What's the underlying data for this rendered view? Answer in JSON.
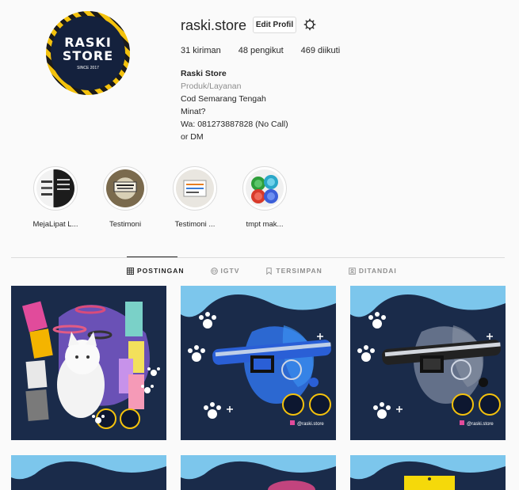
{
  "profile": {
    "avatar_text_line1": "RASKI",
    "avatar_text_line2": "STORE",
    "avatar_small": "SINCE 2017",
    "username": "raski.store",
    "edit_label": "Edit Profil",
    "stats": {
      "posts": "31 kiriman",
      "followers": "48 pengikut",
      "following": "469 diikuti"
    },
    "bio": {
      "name": "Raski Store",
      "category": "Produk/Layanan",
      "line1": "Cod Semarang Tengah",
      "line2": "Minat?",
      "line3": "Wa: 081273887828 (No Call)",
      "line4": "or DM"
    }
  },
  "highlights": [
    {
      "label": "MejaLipat L..."
    },
    {
      "label": "Testimoni"
    },
    {
      "label": "Testimoni ..."
    },
    {
      "label": "tmpt mak..."
    }
  ],
  "tabs": {
    "posts": "POSTINGAN",
    "igtv": "IGTV",
    "saved": "TERSIMPAN",
    "tagged": "DITANDAI"
  },
  "posts": [
    {
      "caption": ""
    },
    {
      "caption": "@raski.store"
    },
    {
      "caption": "@raski.store"
    }
  ],
  "colors": {
    "post_bg": "#1a2b4a",
    "wave": "#7cc6ec",
    "collar_blue": "#2a5fd6",
    "collar_black": "#222222"
  }
}
